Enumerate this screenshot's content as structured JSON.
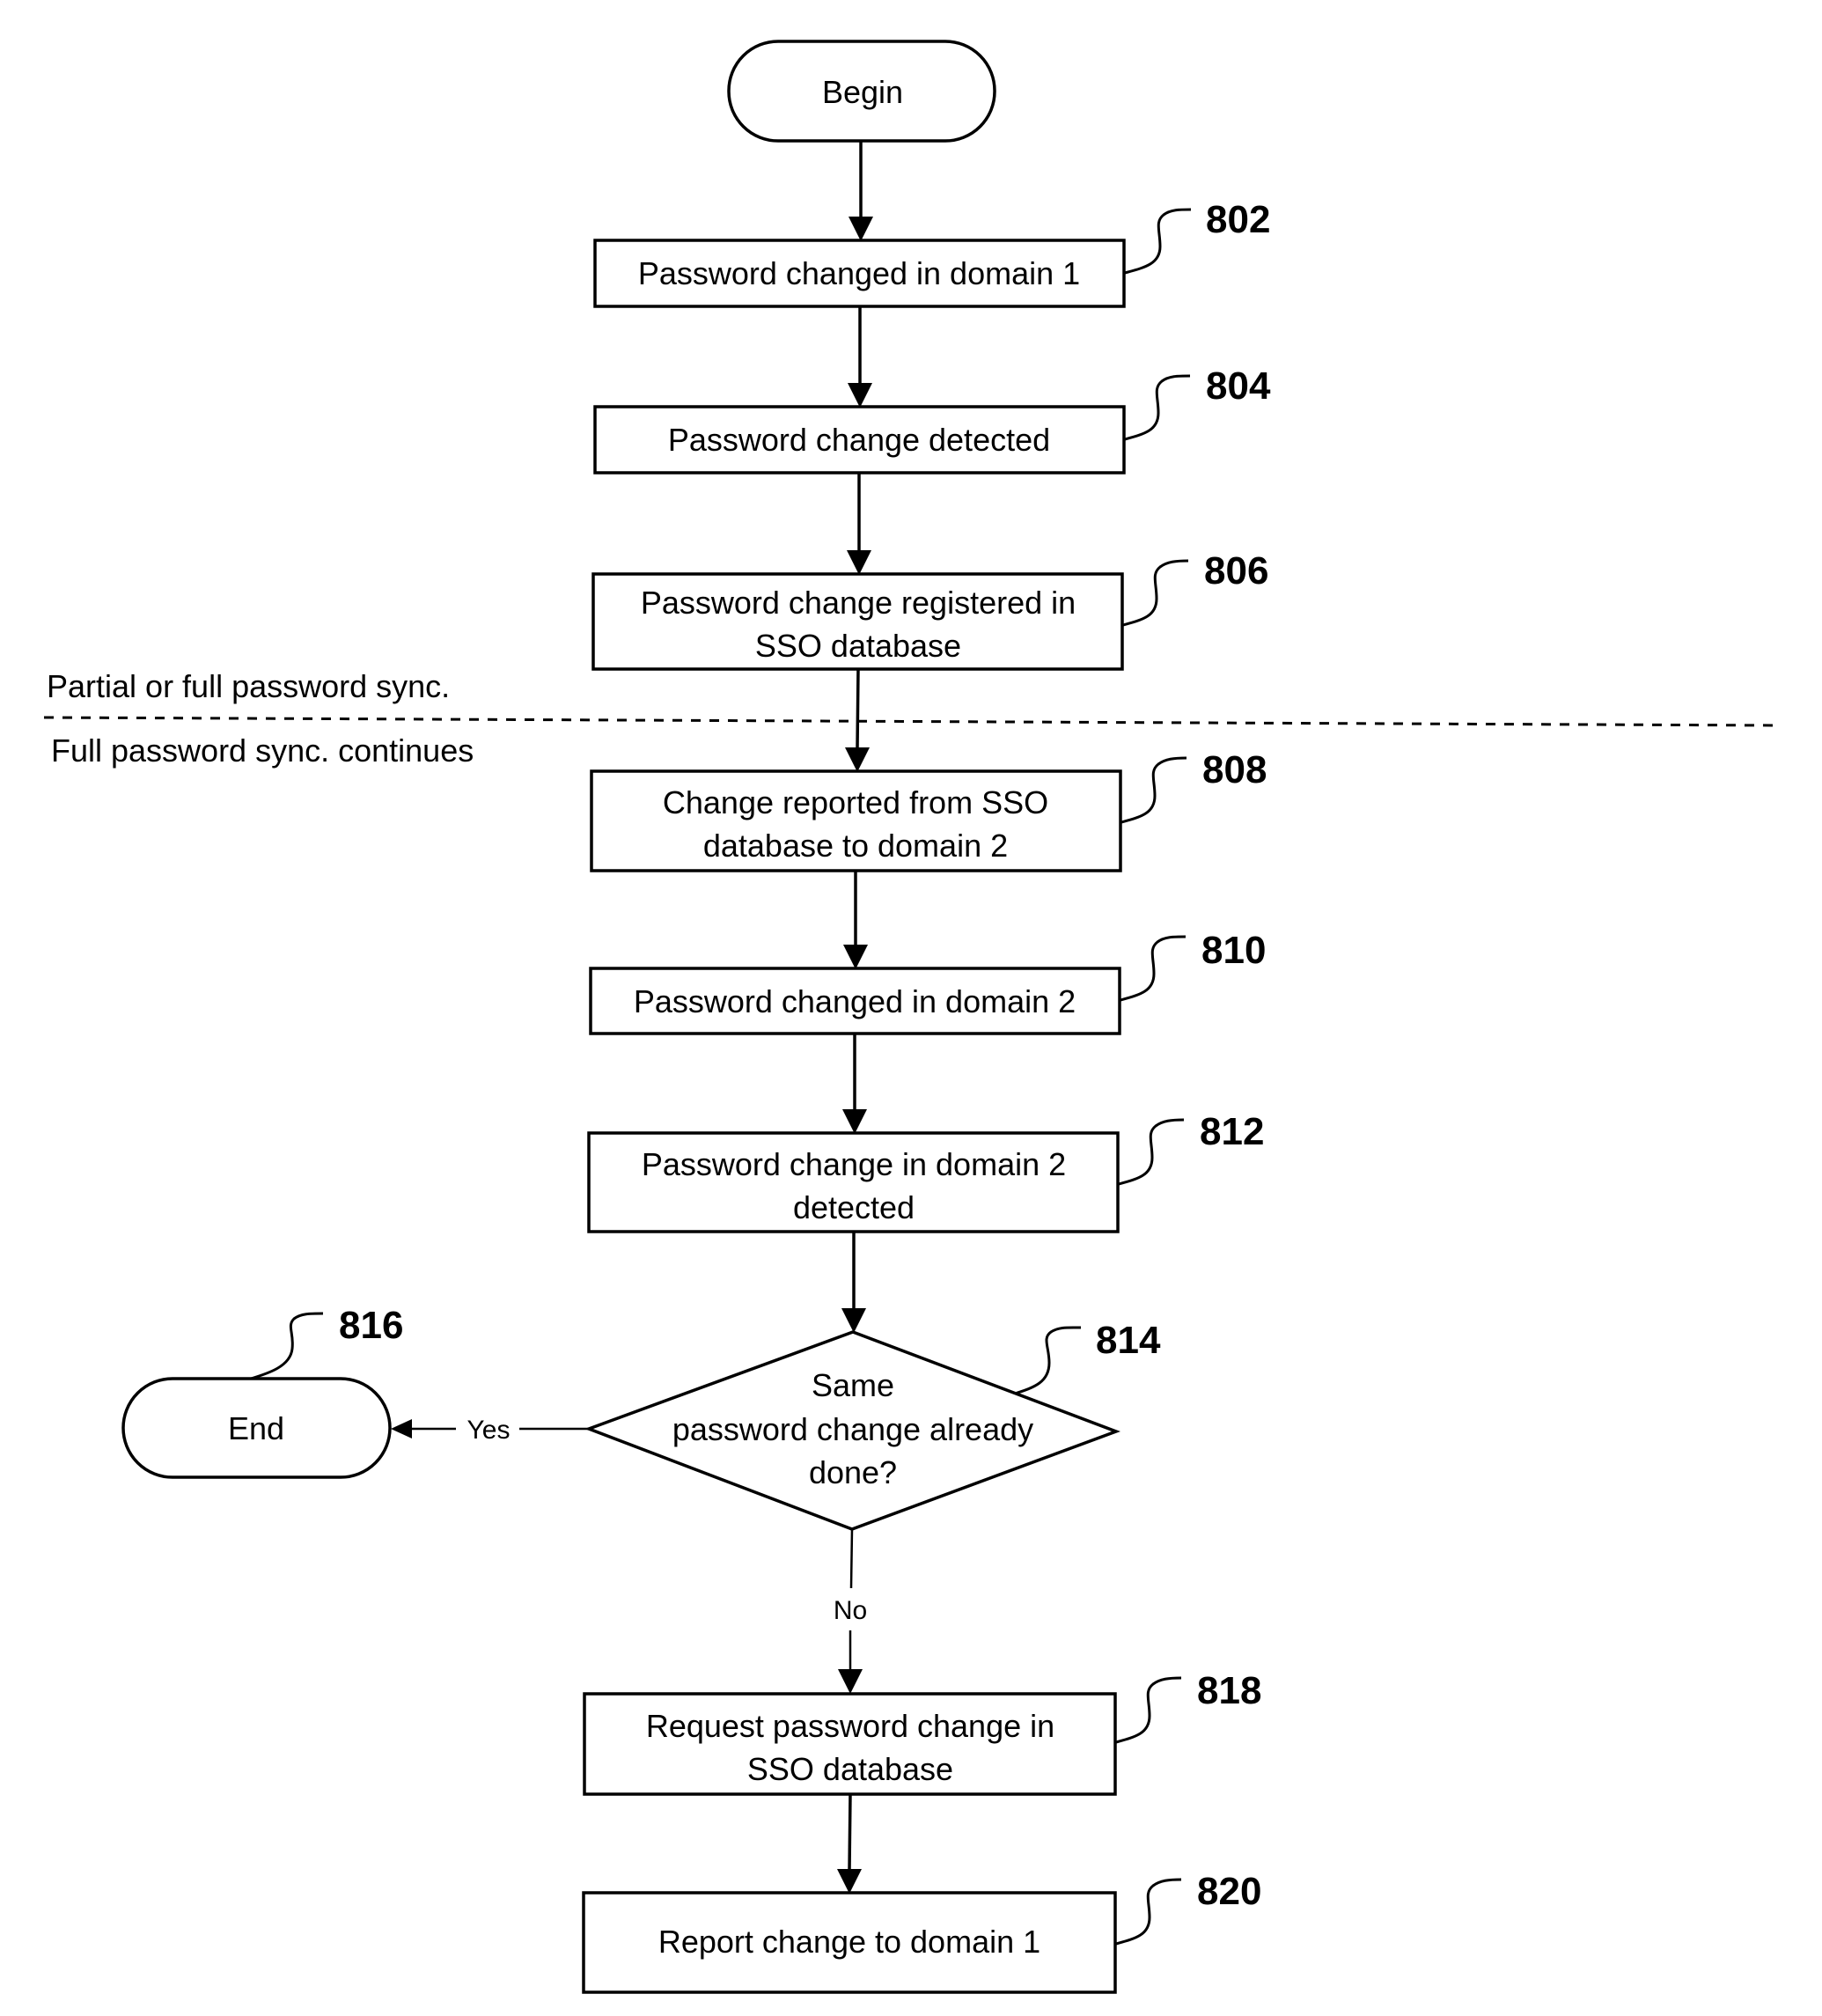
{
  "figure": {
    "type": "flowchart",
    "region_labels": {
      "above_divider": "Partial or full password sync.",
      "below_divider": "Full password sync. continues"
    },
    "terminals": {
      "begin": "Begin",
      "end": {
        "label": "End",
        "ref": "816"
      }
    },
    "steps": [
      {
        "ref": "802",
        "lines": [
          "Password changed in domain 1"
        ]
      },
      {
        "ref": "804",
        "lines": [
          "Password change detected"
        ]
      },
      {
        "ref": "806",
        "lines": [
          "Password change registered in",
          "SSO database"
        ]
      },
      {
        "ref": "808",
        "lines": [
          "Change reported from SSO",
          "database to domain 2"
        ]
      },
      {
        "ref": "810",
        "lines": [
          "Password changed in domain 2"
        ]
      },
      {
        "ref": "812",
        "lines": [
          "Password change in domain 2",
          "detected"
        ]
      }
    ],
    "decision": {
      "ref": "814",
      "lines": [
        "Same",
        "password change already",
        "done?"
      ],
      "yes_label": "Yes",
      "no_label": "No"
    },
    "after_decision": [
      {
        "ref": "818",
        "lines": [
          "Request password change in",
          "SSO database"
        ]
      },
      {
        "ref": "820",
        "lines": [
          "Report change to domain 1"
        ]
      }
    ]
  }
}
